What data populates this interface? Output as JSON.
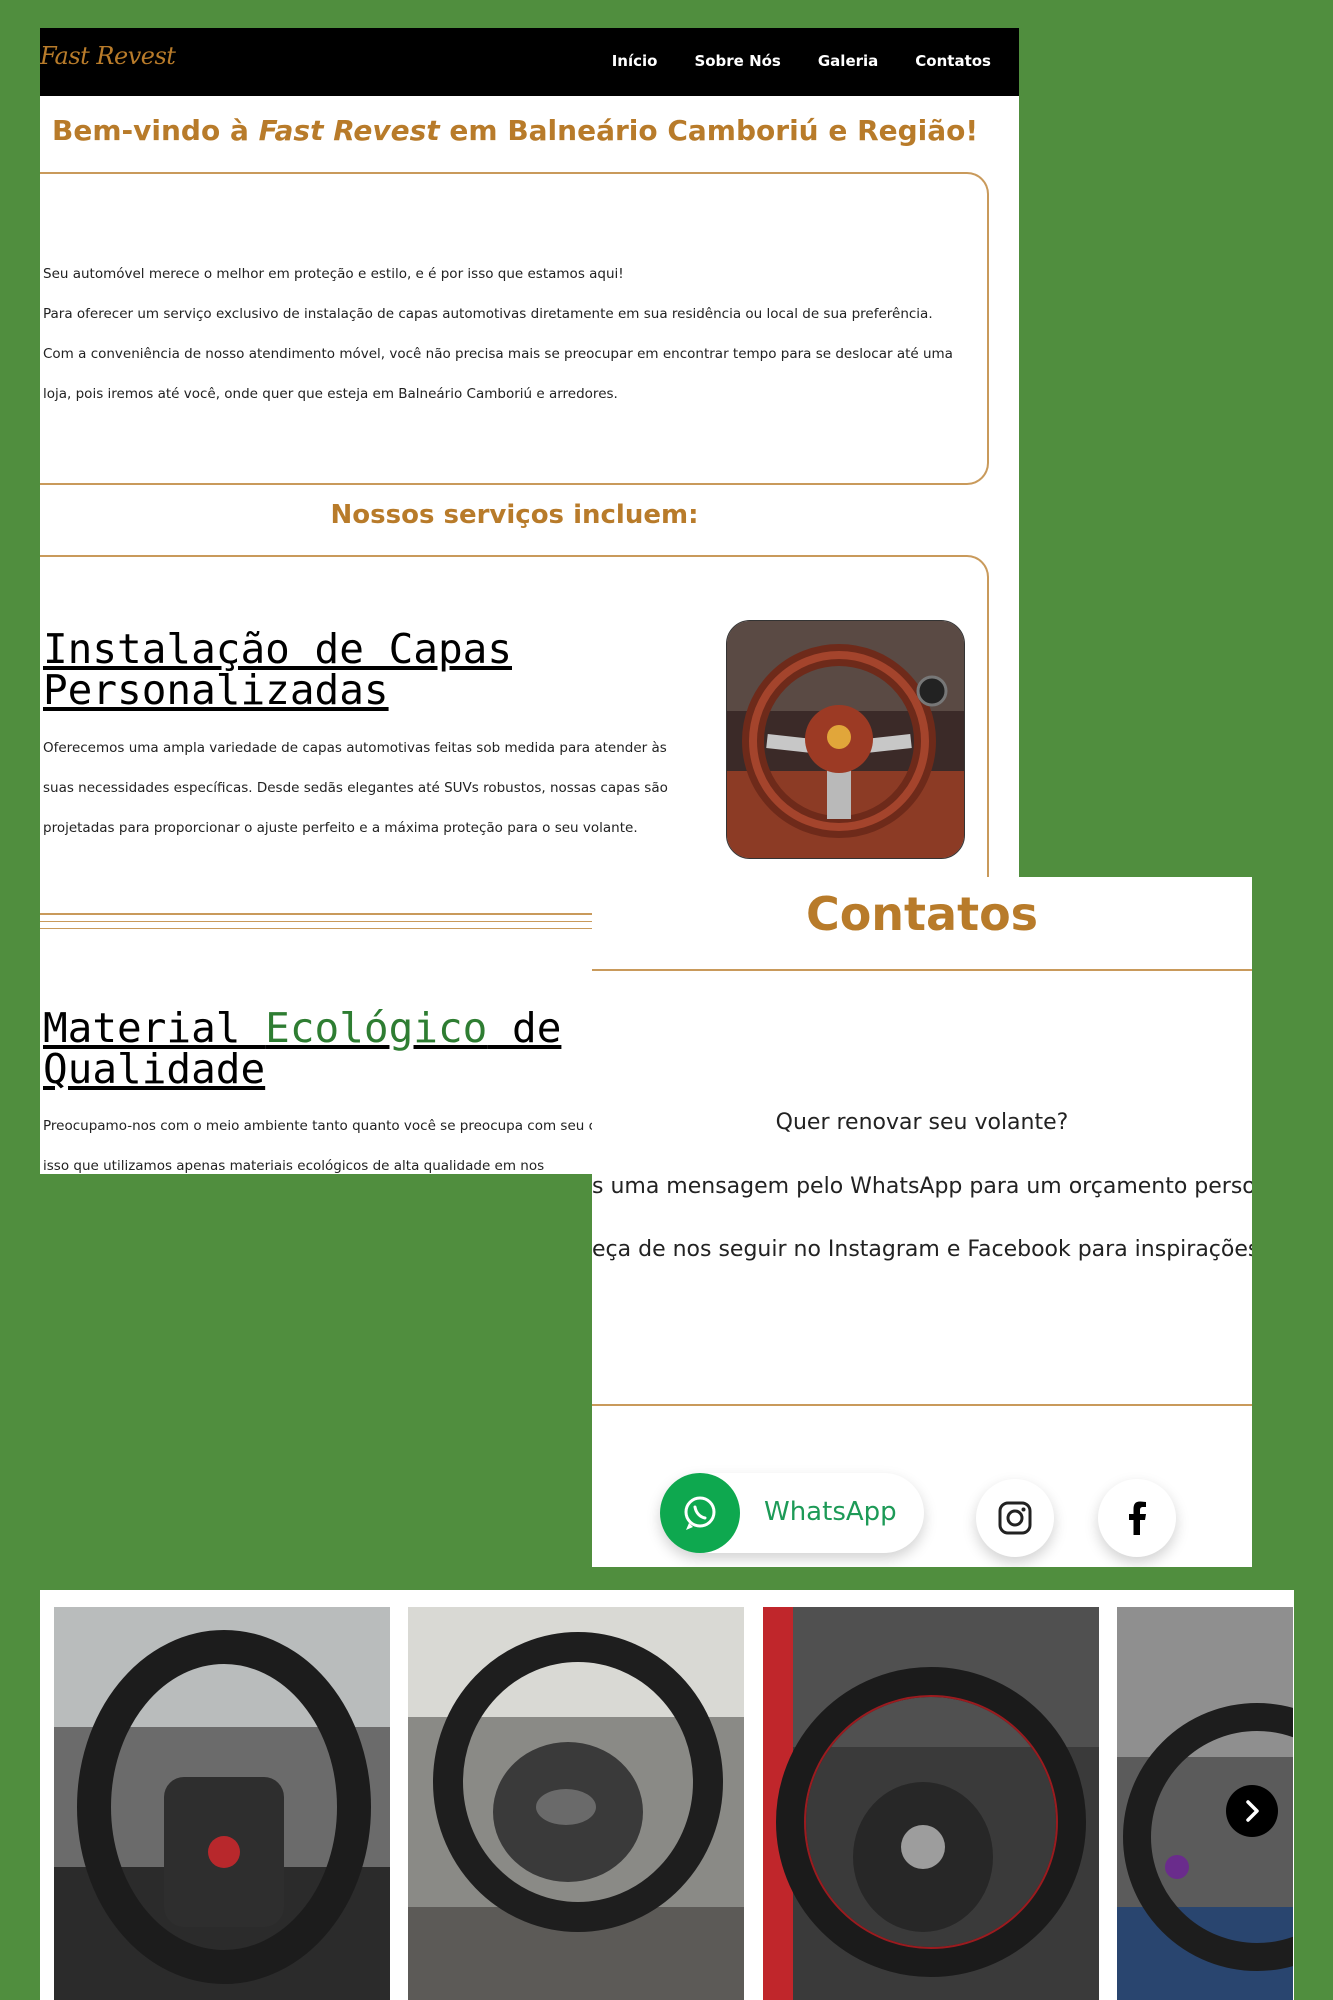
{
  "brand": {
    "logo_text": "Fast Revest",
    "accent_color": "#b87b2a",
    "background_color": "#508e3e"
  },
  "nav": {
    "items": [
      {
        "label": "Início"
      },
      {
        "label": "Sobre Nós"
      },
      {
        "label": "Galeria"
      },
      {
        "label": "Contatos"
      }
    ]
  },
  "welcome": {
    "prefix": "Bem-vindo à ",
    "brand": "Fast Revest",
    "suffix": " em Balneário Camboriú e Região!"
  },
  "intro": {
    "lines": [
      "Seu automóvel merece o melhor em proteção e estilo, e é por isso que estamos aqui!",
      "Para oferecer um serviço exclusivo de instalação de capas automotivas diretamente em sua residência ou local de sua preferência.",
      "Com a conveniência de nosso atendimento móvel, você não precisa mais se preocupar em encontrar tempo para se deslocar até uma",
      "loja, pois iremos até você, onde quer que esteja em Balneário Camboriú e arredores."
    ]
  },
  "services": {
    "title": "Nossos serviços incluem:",
    "items": [
      {
        "title_line1": "Instalação de Capas",
        "title_line2": "Personalizadas",
        "lines": [
          "Oferecemos uma ampla variedade de capas automotivas feitas sob medida para atender às",
          "suas necessidades específicas. Desde sedãs elegantes até SUVs robustos, nossas capas são",
          "projetadas para proporcionar o ajuste perfeito e a máxima proteção para o seu volante."
        ]
      },
      {
        "title_part1": "Material ",
        "title_eco": "Ecológico",
        "title_part2": " de",
        "title_line2": "Qualidade",
        "lines": [
          "Preocupamo-nos com o meio ambiente tanto quanto você se preocupa com seu c",
          "isso que utilizamos apenas materiais ecológicos de alta qualidade em nos"
        ]
      }
    ]
  },
  "contacts": {
    "title": "Contatos",
    "question": "Quer renovar seu volante?",
    "line1": "s uma mensagem pelo WhatsApp para um orçamento perso",
    "line2": "eça de nos seguir no Instagram e Facebook para inspirações",
    "whatsapp_label": "WhatsApp",
    "whatsapp_color": "#0ea84f"
  },
  "gallery": {
    "icons": [
      "steering-wheel-photo",
      "chevron-right-icon"
    ]
  }
}
